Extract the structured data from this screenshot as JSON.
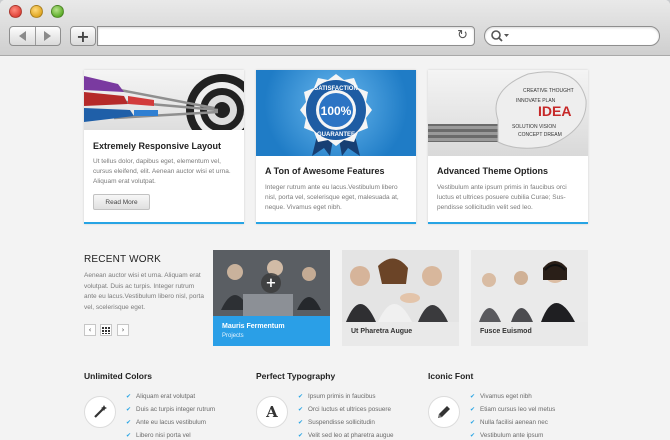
{
  "browser": {
    "icons": {
      "back": "back-arrow-icon",
      "forward": "forward-arrow-icon",
      "new_tab": "plus-icon",
      "reload": "reload-icon",
      "search": "search-icon"
    },
    "new_tab_symbol": "+",
    "reload_symbol": "↻",
    "address_value": ""
  },
  "colors": {
    "accent": "#27a4e4",
    "active_project": "#2a9fe7"
  },
  "cards": [
    {
      "title": "Extremely Responsive Layout",
      "text": "Ut tellus dolor, dapibus eget, elementum vel, cursus eleifend, elit. Aenean auctor wisi et urna. Aliquam erat volutpat.",
      "button": "Read More",
      "image": "darts-target"
    },
    {
      "title": "A Ton of Awesome Features",
      "text": "Integer rutrum ante eu lacus.Vestibulum libero nisl, porta vel, scelerisque eget, malesuada at, neque. Vivamus eget nibh.",
      "image": "satisfaction-badge",
      "badge_top": "SATISFACTION",
      "badge_mid": "100%",
      "badge_bottom": "GUARANTEE"
    },
    {
      "title": "Advanced Theme Options",
      "text": "Vestibulum ante ipsum primis in faucibus orci luctus et ultrices posuere cubilia Curae; Sus-pendisse sollicitudin velit sed leo.",
      "image": "idea-lightbulb",
      "bulb_word": "IDEA"
    }
  ],
  "recent_work": {
    "title": "RECENT WORK",
    "text": "Aenean auctor wisi et urna. Aliquam erat volutpat. Duis ac turpis. Integer rutrum ante eu lacus.Vestibulum libero nisl, porta vel, scelerisque eget.",
    "nav": {
      "prev": "‹",
      "grid": "grid-icon",
      "next": "›"
    },
    "projects": [
      {
        "title": "Mauris Fermentum",
        "subtitle": "Projects",
        "active": true,
        "hover_symbol": "+"
      },
      {
        "title": "Ut Pharetra Augue",
        "active": false
      },
      {
        "title": "Fusce Euismod",
        "active": false
      }
    ]
  },
  "features": [
    {
      "title": "Unlimited Colors",
      "icon": "magic-wand-icon",
      "items": [
        "Aliquam erat volutpat",
        "Duis ac turpis integer rutrum",
        "Ante eu lacus vestibulum",
        "Libero nisi porta vel"
      ]
    },
    {
      "title": "Perfect Typography",
      "icon": "typography-icon",
      "icon_glyph": "A",
      "items": [
        "Ipsum primis in faucibus",
        "Orci luctus et ultrices posuere",
        "Suspendisse sollicitudin",
        "Velit sed leo at pharetra augue"
      ]
    },
    {
      "title": "Iconic Font",
      "icon": "pencil-icon",
      "items": [
        "Vivamus eget nibh",
        "Etiam cursus leo vel metus",
        "Nulla facilisi aenean nec",
        "Vestibulum ante ipsum"
      ]
    }
  ],
  "check_symbol": "✔"
}
